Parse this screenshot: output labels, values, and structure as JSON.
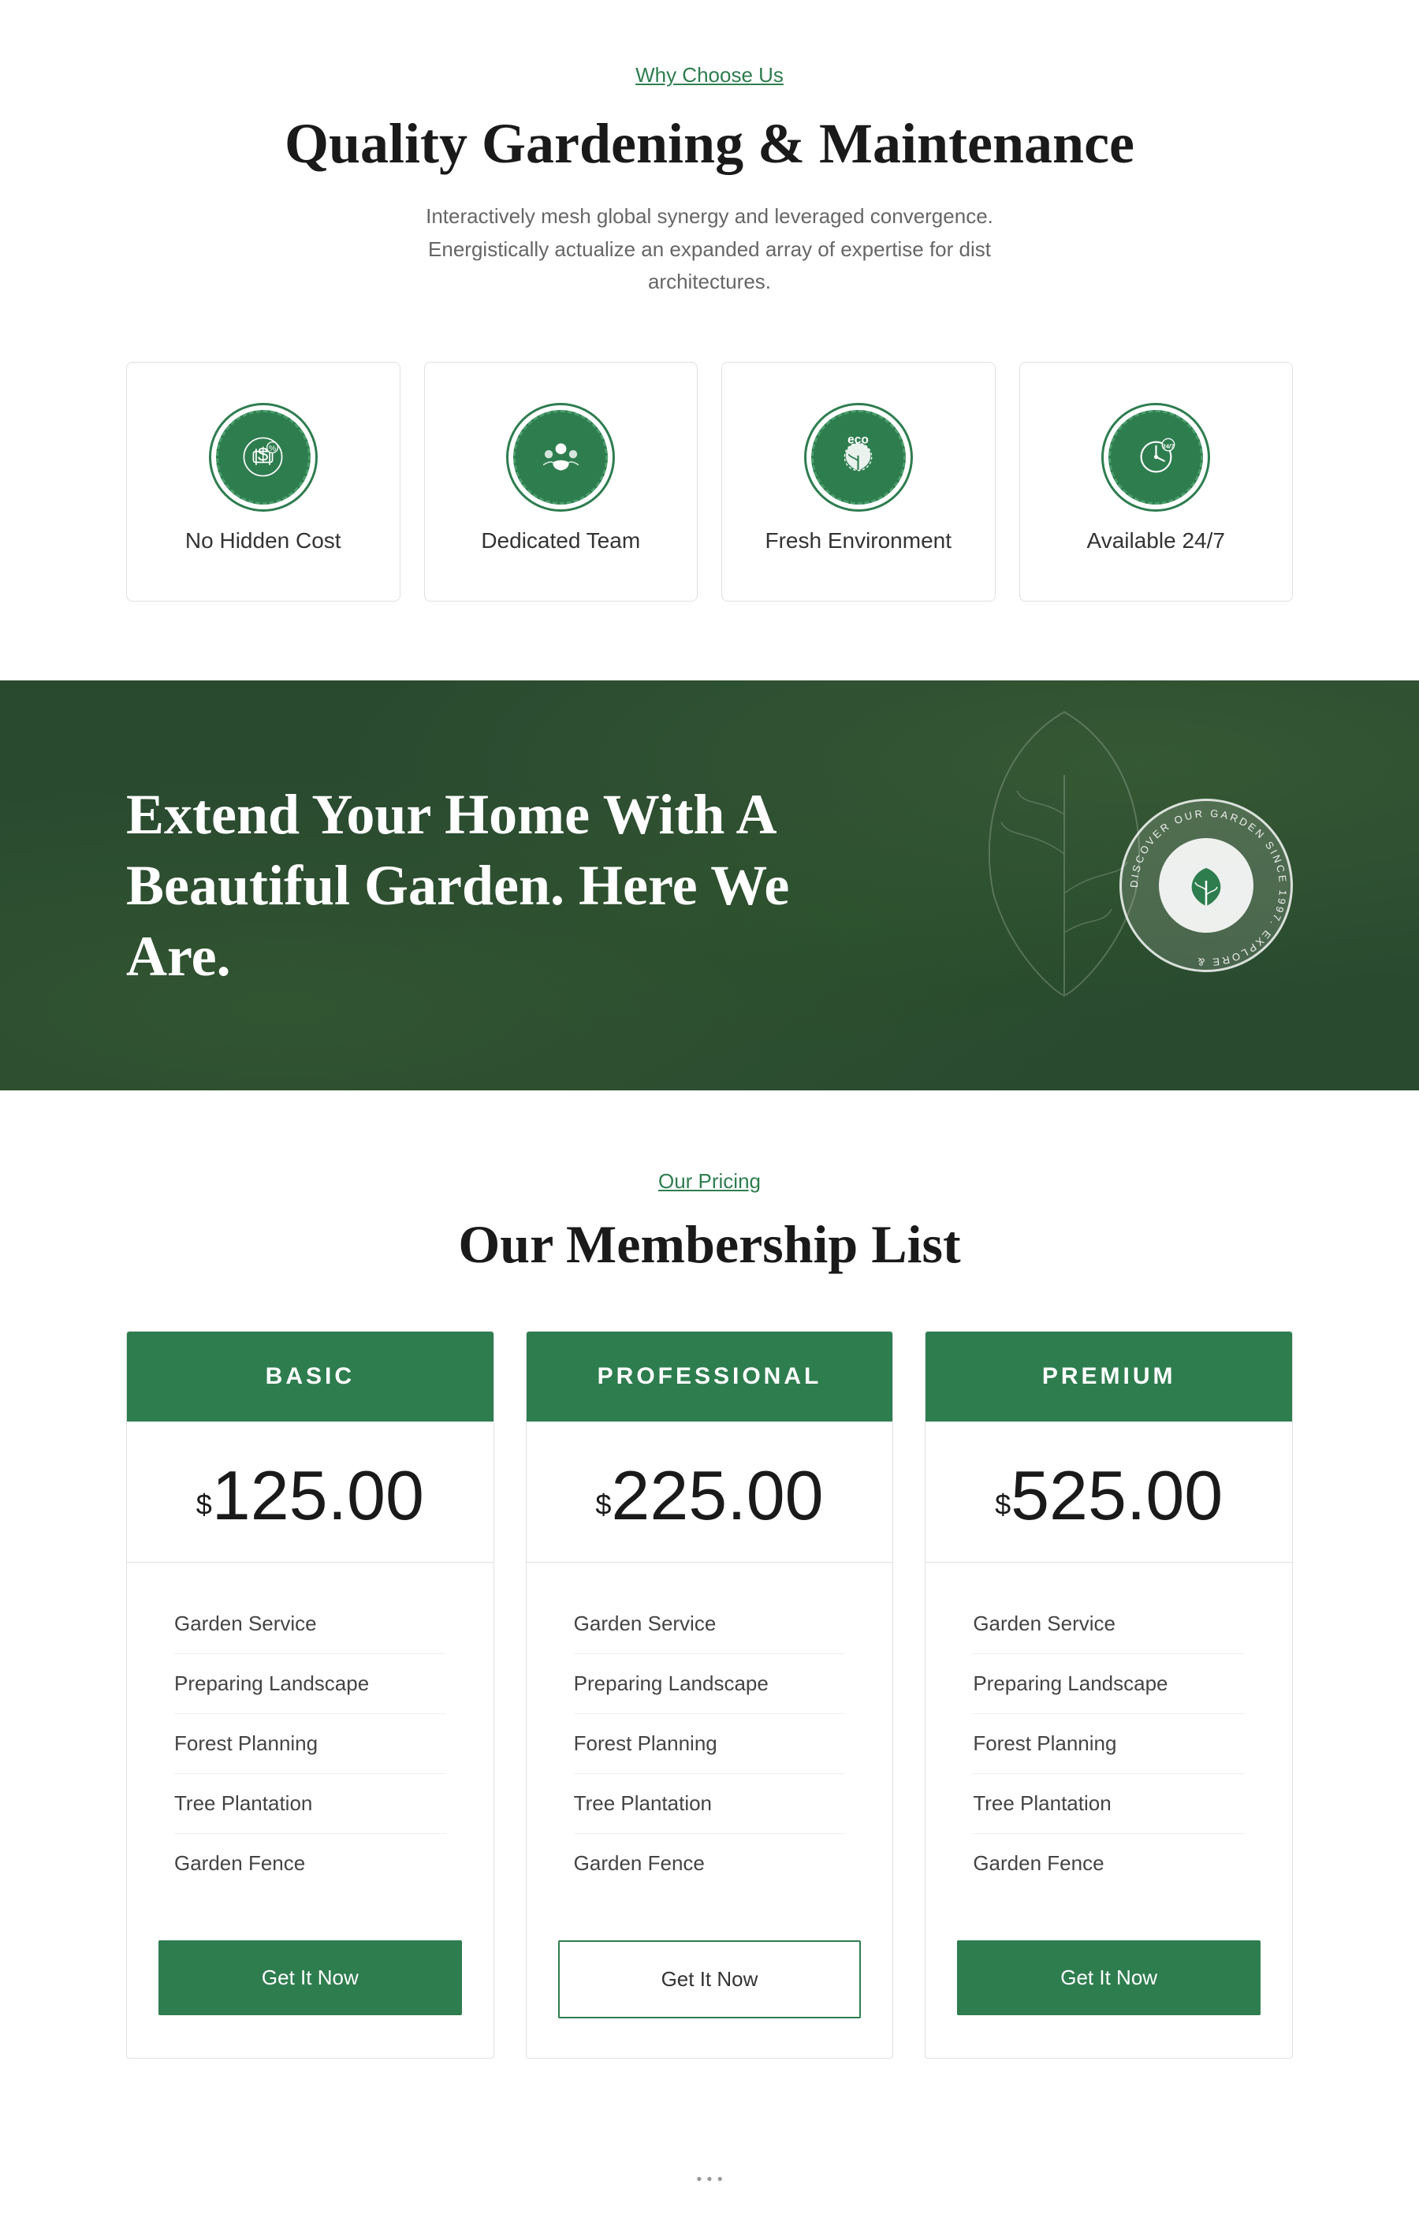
{
  "quality_section": {
    "tag": "Why Choose Us",
    "title": "Quality Gardening & Maintenance",
    "description": "Interactively mesh global synergy and leveraged convergence. Energistically actualize an expanded array of expertise for dist architectures.",
    "features": [
      {
        "id": "no-hidden-cost",
        "label": "No Hidden Cost",
        "icon": "cost-icon"
      },
      {
        "id": "dedicated-team",
        "label": "Dedicated Team",
        "icon": "team-icon"
      },
      {
        "id": "fresh-environment",
        "label": "Fresh Environment",
        "icon": "eco-icon"
      },
      {
        "id": "available-247",
        "label": "Available 24/7",
        "icon": "clock-icon"
      }
    ]
  },
  "banner_section": {
    "headline_line1": "Extend Your Home With A",
    "headline_line2": "Beautiful Garden. Here We Are.",
    "badge_text": "DISCOVER OUR GARDEN SINCE 1997. EXPLORE &"
  },
  "pricing_section": {
    "tag": "Our Pricing",
    "title": "Our Membership List",
    "plans": [
      {
        "id": "basic",
        "name": "BASIC",
        "price": "$125.00",
        "currency": "$",
        "amount": "125.00",
        "features": [
          "Garden Service",
          "Preparing Landscape",
          "Forest Planning",
          "Tree Plantation",
          "Garden Fence"
        ],
        "btn_label": "Get It Now",
        "btn_style": "solid"
      },
      {
        "id": "professional",
        "name": "PROFESSIONAL",
        "price": "$225.00",
        "currency": "$",
        "amount": "225.00",
        "features": [
          "Garden Service",
          "Preparing Landscape",
          "Forest Planning",
          "Tree Plantation",
          "Garden Fence"
        ],
        "btn_label": "Get It Now",
        "btn_style": "outline"
      },
      {
        "id": "premium",
        "name": "PREMIUM",
        "price": "$525.00",
        "currency": "$",
        "amount": "525.00",
        "features": [
          "Garden Service",
          "Preparing Landscape",
          "Forest Planning",
          "Tree Plantation",
          "Garden Fence"
        ],
        "btn_label": "Get It Now",
        "btn_style": "solid"
      }
    ]
  },
  "colors": {
    "primary": "#2e7d4f",
    "text_dark": "#1a1a1a",
    "text_muted": "#666",
    "border": "#e0e0e0"
  }
}
